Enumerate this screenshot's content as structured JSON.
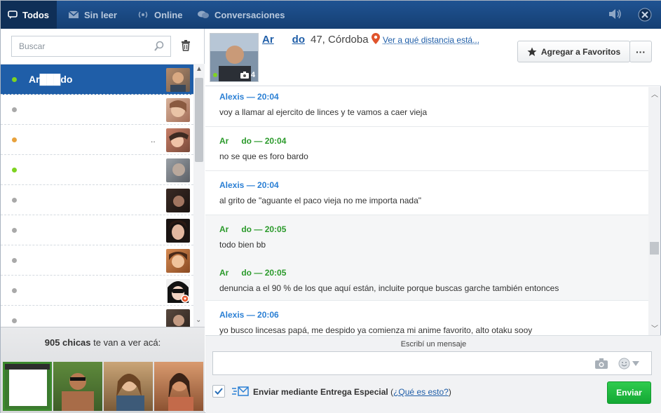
{
  "topbar": {
    "tabs": [
      {
        "label": "Todos",
        "icon": "chat-bubble-icon"
      },
      {
        "label": "Sin leer",
        "icon": "envelope-icon"
      },
      {
        "label": "Online",
        "icon": "signal-icon"
      },
      {
        "label": "Conversaciones",
        "icon": "chats-icon"
      }
    ],
    "sound_icon": "speaker-icon",
    "close_icon": "close-icon"
  },
  "sidebar": {
    "search_placeholder": "Buscar",
    "contacts": [
      {
        "name": "Ar███do",
        "status": "online",
        "status_color": "#7ed321",
        "active": true
      },
      {
        "name": "",
        "status": "offline",
        "status_color": "#a9a9a9"
      },
      {
        "name": "",
        "status": "away",
        "status_color": "#e8a23c",
        "trail": ".."
      },
      {
        "name": "",
        "status": "online",
        "status_color": "#7ed321"
      },
      {
        "name": "",
        "status": "offline",
        "status_color": "#a9a9a9"
      },
      {
        "name": "",
        "status": "offline",
        "status_color": "#a9a9a9"
      },
      {
        "name": "",
        "status": "offline",
        "status_color": "#a9a9a9"
      },
      {
        "name": "",
        "status": "offline",
        "status_color": "#a9a9a9",
        "badge": "heart-badge-icon"
      },
      {
        "name": "",
        "status": "offline",
        "status_color": "#a9a9a9"
      }
    ],
    "promo": {
      "count": "905 chicas",
      "text": "te van a ver acá:"
    }
  },
  "profile": {
    "name": "Ar",
    "name_end": "do",
    "info": "47, Córdoba",
    "distance_link": "Ver a qué distancia está...",
    "photo_count": "4",
    "favorite_label": "Agregar a Favoritos",
    "more_label": "···"
  },
  "messages": [
    {
      "author": "Alexis",
      "time": "— 20:04",
      "text": "voy a llamar al ejercito de linces y te vamos a caer vieja",
      "mine": false
    },
    {
      "author": "Ar",
      "author_end": "do",
      "time": "— 20:04",
      "text": "no se que es foro bardo",
      "mine": true
    },
    {
      "author": "Alexis",
      "time": "— 20:04",
      "text": "al grito de \"aguante el paco vieja no me importa nada\"",
      "mine": false
    },
    {
      "author": "Ar",
      "author_end": "do",
      "time": "— 20:05",
      "text": "todo bien bb",
      "mine": true
    },
    {
      "author": "Ar",
      "author_end": "do",
      "time": "— 20:05",
      "text": "denuncia a el 90 % de los que aquí están, incluite porque buscas garche también entonces",
      "mine": true
    },
    {
      "author": "Alexis",
      "time": "— 20:06",
      "text": "yo busco lincesas papá, me despido ya comienza mi anime favorito, alto otaku sooy",
      "mine": false
    }
  ],
  "composer": {
    "label": "Escribí un mensaje",
    "special_label": "Enviar mediante Entrega Especial",
    "special_link": "¿Qué es esto?",
    "send_label": "Enviar"
  },
  "colors": {
    "topbar": "#1a4a85",
    "active_row": "#1f5ea8",
    "author_other": "#2a7fd4",
    "author_self": "#2b9a2b",
    "send": "#22b340"
  }
}
